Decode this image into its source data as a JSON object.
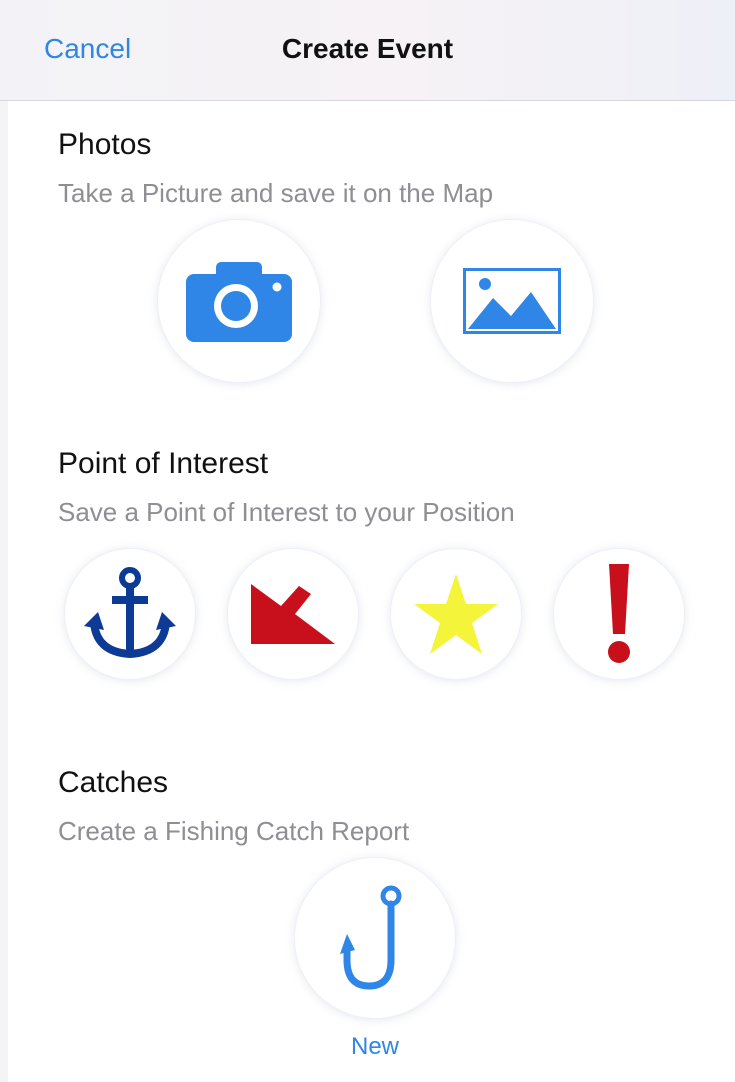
{
  "nav": {
    "cancel_label": "Cancel",
    "title": "Create Event"
  },
  "photos": {
    "title": "Photos",
    "subtitle": "Take a Picture and save it on the Map",
    "buttons": [
      {
        "icon": "camera-icon",
        "color": "#2f86e6"
      },
      {
        "icon": "image-icon",
        "color": "#2f86e6"
      }
    ]
  },
  "poi": {
    "title": "Point of Interest",
    "subtitle": "Save a Point of Interest to your Position",
    "buttons": [
      {
        "icon": "anchor-icon",
        "color": "#0d3a94"
      },
      {
        "icon": "arrow-down-left-icon",
        "color": "#c8101c"
      },
      {
        "icon": "star-icon",
        "color": "#f4f43a"
      },
      {
        "icon": "exclamation-icon",
        "color": "#c8101c"
      }
    ]
  },
  "catches": {
    "title": "Catches",
    "subtitle": "Create a Fishing Catch Report",
    "button": {
      "icon": "fish-hook-icon",
      "color": "#2f86e6"
    },
    "new_label": "New"
  },
  "colors": {
    "accent": "#2f86e6",
    "subtitle": "#8e8e93"
  }
}
